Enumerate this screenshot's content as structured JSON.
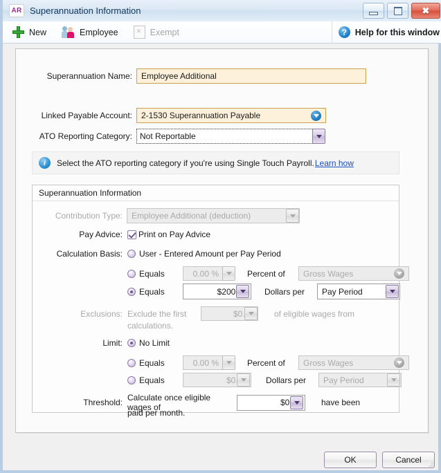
{
  "window": {
    "app_badge": "AR",
    "title": "Superannuation Information",
    "minimize_icon": "minimize-icon",
    "maximize_icon": "maximize-icon",
    "close_icon": "close-icon",
    "close_glyph": "✖"
  },
  "toolbar": {
    "new_label": "New",
    "new_icon": "plus-icon",
    "employee_label": "Employee",
    "employee_icon": "people-icon",
    "exempt_label": "Exempt",
    "exempt_icon": "page-icon",
    "help_label": "Help for this window",
    "help_icon": "question-mark-icon",
    "help_glyph": "?"
  },
  "form": {
    "super_name_label": "Superannuation Name:",
    "super_name_value": "Employee Additional",
    "linked_account_label": "Linked Payable Account:",
    "linked_account_value": "2-1530 Superannuation Payable",
    "linked_account_icon": "dropdown-circle-icon",
    "ato_label": "ATO Reporting Category:",
    "ato_value": "Not Reportable",
    "ato_icon": "chevron-down-icon"
  },
  "banner": {
    "icon": "info-icon",
    "glyph": "i",
    "text": "Select the ATO reporting category if you're using Single Touch Payroll.",
    "link": "Learn how"
  },
  "group": {
    "title": "Superannuation Information",
    "contribution_type_label": "Contribution Type:",
    "contribution_type_value": "Employee Additional (deduction)",
    "pay_advice_label": "Pay Advice:",
    "pay_advice_checkbox": "Print on Pay Advice",
    "pay_advice_checked": true
  },
  "calculation_basis": {
    "label": "Calculation Basis:",
    "option1_label": "User - Entered Amount per Pay Period",
    "option1_selected": false,
    "option2_label": "Equals",
    "option2_selected": false,
    "option2_value": "0.00 %",
    "option2_mid_label": "Percent of",
    "option2_basis": "Gross Wages",
    "option3_label": "Equals",
    "option3_selected": true,
    "option3_value": "$200.00",
    "option3_mid_label": "Dollars per",
    "option3_basis": "Pay Period"
  },
  "exclusions": {
    "label": "Exclusions:",
    "prefix": "Exclude the first",
    "value": "$0.00",
    "suffix": "of eligible wages from",
    "suffix2": "calculations."
  },
  "limit": {
    "label": "Limit:",
    "option1_label": "No Limit",
    "option1_selected": true,
    "option2_label": "Equals",
    "option2_selected": false,
    "option2_value": "0.00 %",
    "option2_mid_label": "Percent of",
    "option2_basis": "Gross Wages",
    "option3_label": "Equals",
    "option3_selected": false,
    "option3_value": "$0.00",
    "option3_mid_label": "Dollars per",
    "option3_basis": "Pay Period"
  },
  "threshold": {
    "label": "Threshold:",
    "prefix": "Calculate once eligible wages of",
    "value": "$0.00",
    "suffix": "have been",
    "suffix2": "paid per month."
  },
  "footer": {
    "ok_label": "OK",
    "cancel_label": "Cancel"
  },
  "colors": {
    "accent_field_border": "#c8a04e",
    "accent_field_bg": "#fdf1dc",
    "link": "#1a4fbf",
    "brand_badge": "#9c2a8f",
    "purple_control": "#8d7aa8"
  }
}
